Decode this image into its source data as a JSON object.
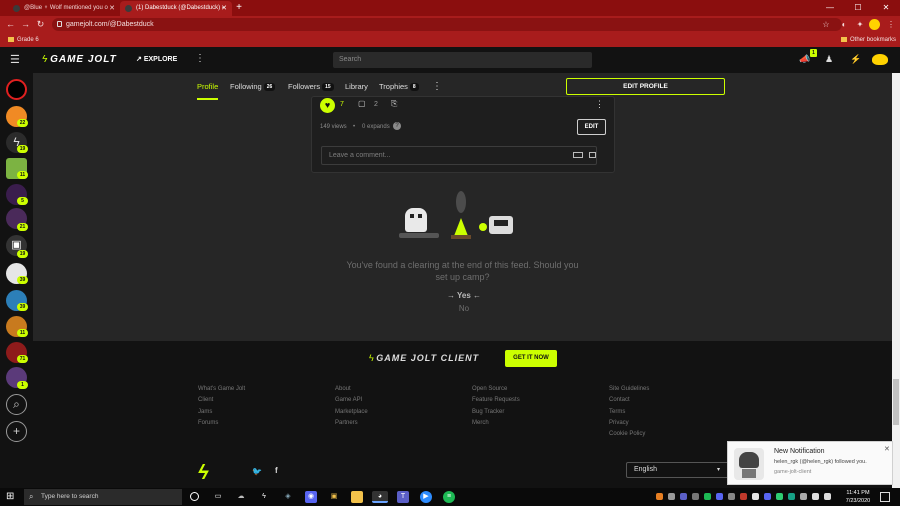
{
  "browser": {
    "tabs": [
      {
        "title": "@Blue ♆ Wolf mentioned you o"
      },
      {
        "title": "(1) Dabestduck (@Dabestduck) -"
      }
    ],
    "new_tab": "+",
    "url": "gamejolt.com/@Dabestduck",
    "bookmarks": {
      "left": "Grade 6",
      "right": "Other bookmarks"
    },
    "window_controls": {
      "min": "—",
      "max": "☐",
      "close": "✕"
    }
  },
  "gj_header": {
    "logo": "GAME JOLT",
    "explore": "EXPLORE",
    "search_placeholder": "Search",
    "notification_count": "1"
  },
  "sidebar": {
    "badges": [
      "22",
      "19",
      "11",
      "5",
      "21",
      "19",
      "39",
      "39",
      "11",
      "71",
      "1"
    ]
  },
  "profile_nav": {
    "tabs": [
      {
        "label": "Profile"
      },
      {
        "label": "Following",
        "count": "26"
      },
      {
        "label": "Followers",
        "count": "15"
      },
      {
        "label": "Library"
      },
      {
        "label": "Trophies",
        "count": "8"
      }
    ],
    "edit_profile": "EDIT PROFILE"
  },
  "post": {
    "likes": "7",
    "comments": "2",
    "views": "149 views",
    "expands": "0 expands",
    "edit_label": "EDIT",
    "comment_placeholder": "Leave a comment..."
  },
  "feed_end": {
    "message_line1": "You've found a clearing at the end of this feed. Should you",
    "message_line2": "set up camp?",
    "yes": "Yes",
    "no": "No"
  },
  "footer": {
    "client_logo": "GAME JOLT CLIENT",
    "get_it_now": "GET IT NOW",
    "col1": [
      "What's Game Jolt",
      "Client",
      "Jams",
      "Forums"
    ],
    "col2": [
      "About",
      "Game API",
      "Marketplace",
      "Partners"
    ],
    "col3": [
      "Open Source",
      "Feature Requests",
      "Bug Tracker",
      "Merch"
    ],
    "col4": [
      "Site Guidelines",
      "Contact",
      "Terms",
      "Privacy",
      "Cookie Policy"
    ],
    "language": "English"
  },
  "notification": {
    "title": "New Notification",
    "body": "helen_rgk (@helen_rgk) followed you.",
    "source": "game-jolt-client",
    "close": "✕"
  },
  "taskbar": {
    "search_placeholder": "Type here to search",
    "time": "11:41 PM",
    "date": "7/23/2020"
  },
  "colors": {
    "accent": "#ccff00",
    "browser_red": "#a81c1c",
    "page_bg": "#262626"
  }
}
